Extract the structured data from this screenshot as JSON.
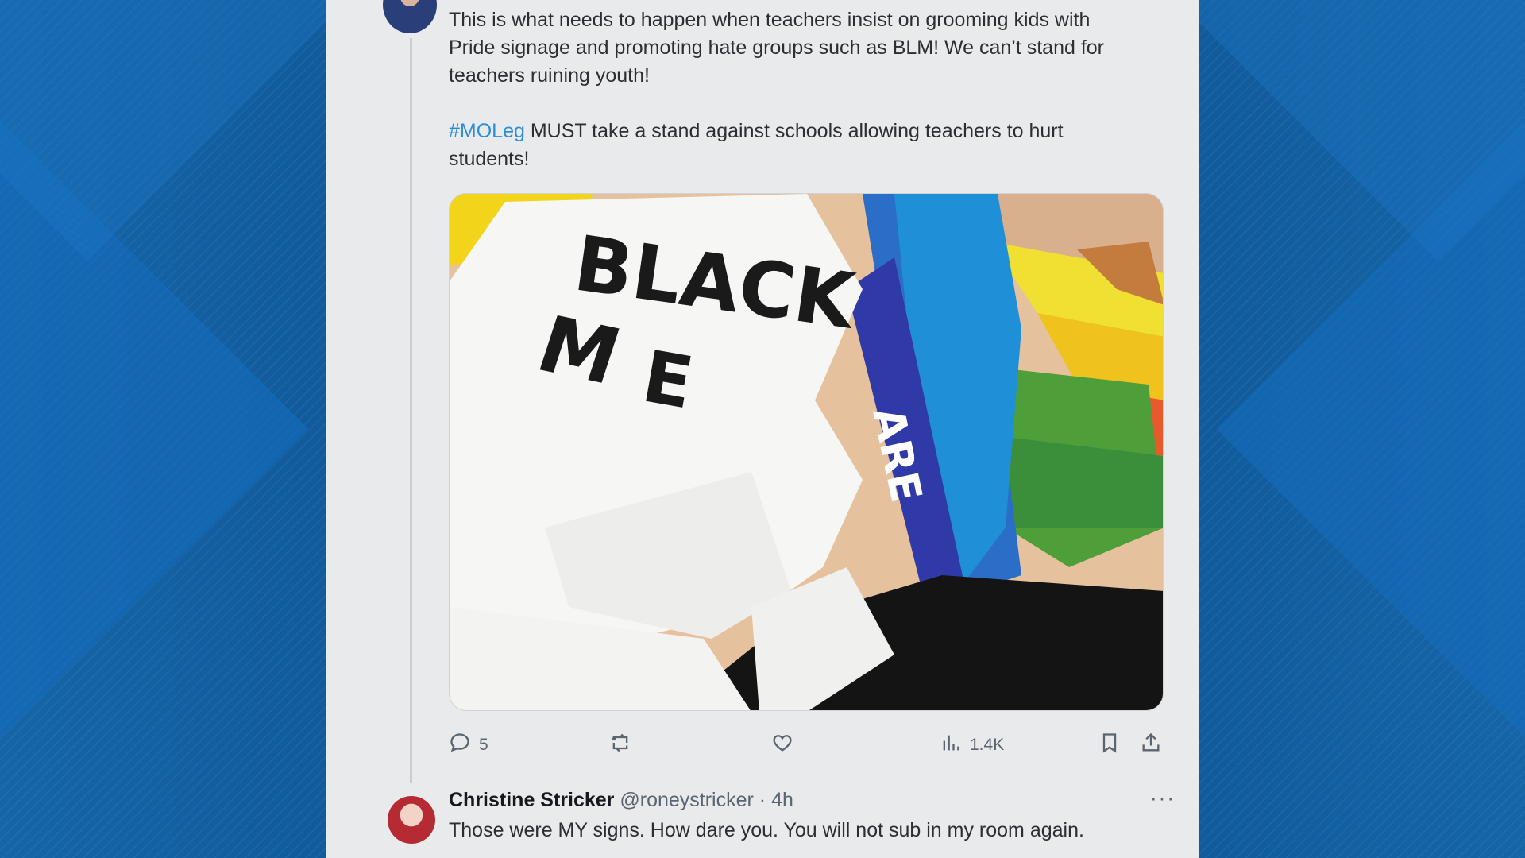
{
  "tweet": {
    "text_line1": "This is what needs to happen when teachers insist on grooming kids with",
    "text_line2": "Pride signage and promoting hate groups such as BLM!  We can’t stand for",
    "text_line3": "teachers ruining youth!",
    "hashtag": "#MOLeg",
    "text_line4": " MUST take a stand against schools allowing teachers to hurt",
    "text_line5": "students!",
    "media_text_black": "BLACK",
    "media_text_are": "ARE",
    "actions": {
      "reply_count": "5",
      "views_count": "1.4K"
    }
  },
  "reply": {
    "name": "Christine Stricker",
    "handle": "@roneystricker",
    "separator": " · ",
    "time": "4h",
    "more": "···",
    "text": "Those were MY signs. How dare you. You will not sub in my room again."
  },
  "icons": {
    "reply": "comment-icon",
    "retweet": "retweet-icon",
    "like": "heart-icon",
    "views": "views-chart-icon",
    "bookmark": "bookmark-icon",
    "share": "share-icon"
  },
  "colors": {
    "hashtag": "#2d8ed8",
    "panel": "#e9eaec",
    "background": "#145a9c"
  }
}
